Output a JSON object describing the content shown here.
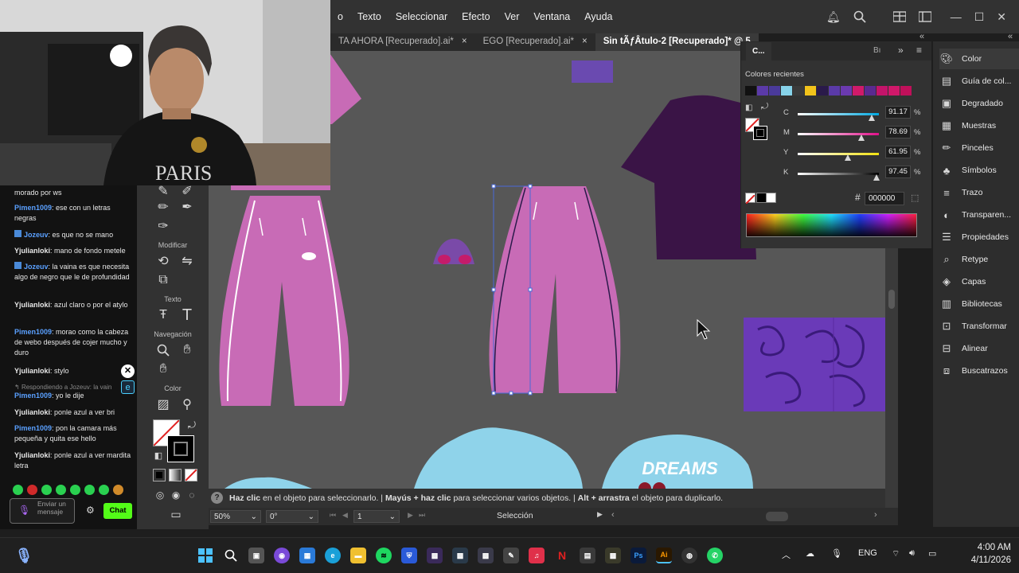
{
  "menubar": {
    "items": [
      "o",
      "Texto",
      "Seleccionar",
      "Efecto",
      "Ver",
      "Ventana",
      "Ayuda"
    ]
  },
  "tabs": [
    {
      "label": "TA AHORA [Recuperado].ai*",
      "close": "×"
    },
    {
      "label": "EGO [Recuperado].ai*",
      "close": "×"
    },
    {
      "label": "Sin tÃƒÂtulo-2 [Recuperado]* @ 5",
      "close": ""
    }
  ],
  "tools": {
    "modificar": "Modificar",
    "texto": "Texto",
    "navegacion": "Navegación",
    "color": "Color"
  },
  "canvas": {
    "tshirt_text": "DREAMS"
  },
  "status": {
    "p1_bold": "Haz clic",
    "p1_rest": " en el objeto para seleccionarlo.  |  ",
    "p2_bold": "Mayús + haz clic",
    "p2_rest": " para seleccionar varios objetos.  |  ",
    "p3_bold": "Alt + arrastra",
    "p3_rest": " el objeto para duplicarlo."
  },
  "bottombar": {
    "zoom": "50%",
    "rotation": "0°",
    "artboard": "1",
    "mode": "Selección"
  },
  "color_panel": {
    "tab_label": "C...",
    "tab_b": "Bı",
    "recent_label": "Colores recientes",
    "recent_swatches": [
      "#111111",
      "#5b3aa8",
      "#4a3a9a",
      "#87d3ea",
      "#3a3a3a",
      "#f2c31b",
      "#2a1a4a",
      "#5a3aa8",
      "#6b3ab0",
      "#d01a6a",
      "#5a2a90",
      "#c4146a",
      "#d0186a",
      "#c0105a"
    ],
    "channels": [
      {
        "label": "C",
        "value": "91.17",
        "unit": "%",
        "frac": 0.9117
      },
      {
        "label": "M",
        "value": "78.69",
        "unit": "%",
        "frac": 0.7869
      },
      {
        "label": "Y",
        "value": "61.95",
        "unit": "%",
        "frac": 0.6195
      },
      {
        "label": "K",
        "value": "97.45",
        "unit": "%",
        "frac": 0.9745
      }
    ],
    "hex_symbol": "#",
    "hex": "000000"
  },
  "dock": [
    {
      "label": "Color",
      "icon": "palette-icon"
    },
    {
      "label": "Guía de col...",
      "icon": "color-guide-icon"
    },
    {
      "label": "Degradado",
      "icon": "gradient-icon"
    },
    {
      "label": "Muestras",
      "icon": "swatches-icon"
    },
    {
      "label": "Pinceles",
      "icon": "brush-icon"
    },
    {
      "label": "Símbolos",
      "icon": "symbols-icon"
    },
    {
      "label": "Trazo",
      "icon": "stroke-icon"
    },
    {
      "label": "Transparen...",
      "icon": "transparency-icon"
    },
    {
      "label": "Propiedades",
      "icon": "properties-icon"
    },
    {
      "label": "Retype",
      "icon": "retype-icon"
    },
    {
      "label": "Capas",
      "icon": "layers-icon"
    },
    {
      "label": "Bibliotecas",
      "icon": "libraries-icon"
    },
    {
      "label": "Transformar",
      "icon": "transform-icon"
    },
    {
      "label": "Alinear",
      "icon": "align-icon"
    },
    {
      "label": "Buscatrazos",
      "icon": "pathfinder-icon"
    }
  ],
  "chat": {
    "messages": [
      {
        "user": "",
        "text": "morado por ws",
        "color": "#e8e8e8"
      },
      {
        "user": "Pimen1009",
        "text": ": ese con un letras negras",
        "color": "#5aa0ff"
      },
      {
        "user": "Jozeuv",
        "text": ": es que no se mano",
        "color": "#5aa0ff"
      },
      {
        "user": "Yjulianloki",
        "text": ": mano de fondo metele",
        "color": "#e8e8e8"
      },
      {
        "user": "Jozeuv",
        "text": ": la vaina es que necesita algo de negro que le de profundidad",
        "color": "#5aa0ff"
      },
      {
        "user": "Yjulianloki",
        "text": ": azul claro o por el atylo",
        "color": "#e8e8e8"
      },
      {
        "user": "Pimen1009",
        "text": ": morao como la cabeza de webo después de cojer mucho y duro",
        "color": "#5aa0ff"
      },
      {
        "user": "Yjulianloki",
        "text": ": stylo",
        "color": "#e8e8e8"
      },
      {
        "user": "Pimen1009",
        "text": ": yo le dije",
        "color": "#5aa0ff"
      },
      {
        "user": "Yjulianloki",
        "text": ": ponle azul a ver bri",
        "color": "#e8e8e8"
      },
      {
        "user": "Pimen1009",
        "text": ": pon la camara más pequeña y quita ese hello",
        "color": "#5aa0ff"
      },
      {
        "user": "Yjulianloki",
        "text": ": ponle azul a ver mardita letra",
        "color": "#e8e8e8"
      }
    ],
    "reply_note": "Respondiendo a Jozeuv: la vain",
    "input_placeholder": "Enviar un mensaje",
    "chat_button": "Chat"
  },
  "taskbar": {
    "lang": "ENG",
    "time": "4:00 AM",
    "date": "4/11/2026",
    "ps_label": "Ps",
    "ai_label": "Ai"
  }
}
